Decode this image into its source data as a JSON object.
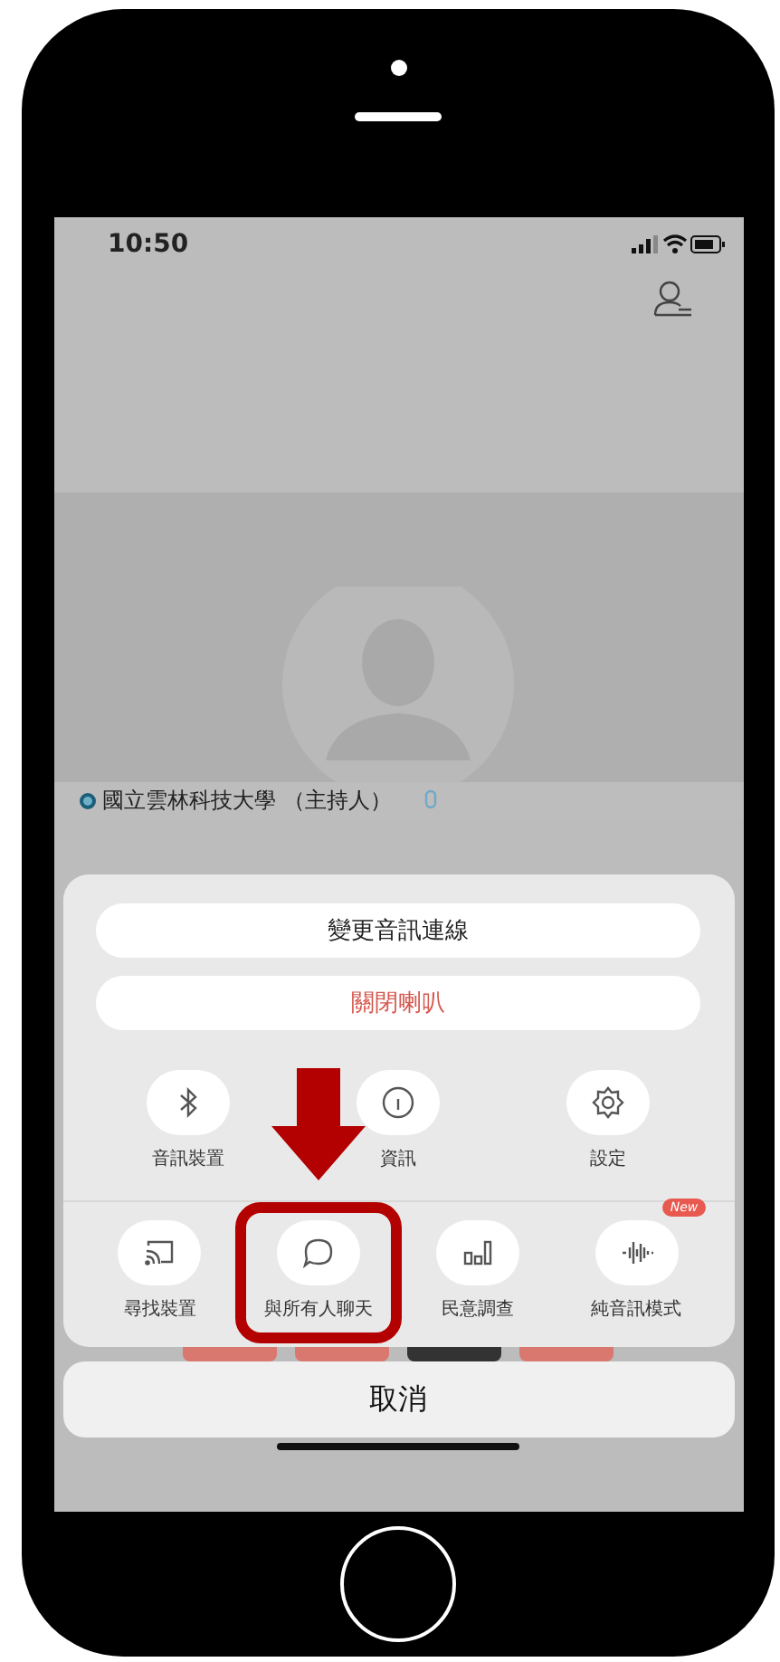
{
  "status_bar": {
    "time": "10:50"
  },
  "participant": {
    "name": "國立雲林科技大學 （主持人）"
  },
  "sheet": {
    "buttons": [
      {
        "label": "變更音訊連線",
        "kind": "normal"
      },
      {
        "label": "關閉喇叭",
        "kind": "danger"
      }
    ],
    "rows": [
      {
        "items": [
          {
            "label": "音訊裝置",
            "highlighted": false
          },
          {
            "label": "資訊",
            "highlighted": false
          },
          {
            "label": "設定",
            "highlighted": false
          }
        ]
      },
      {
        "items": [
          {
            "label": "尋找裝置",
            "highlighted": false
          },
          {
            "label": "與所有人聊天",
            "highlighted": true
          },
          {
            "label": "民意調查",
            "highlighted": false
          },
          {
            "label": "純音訊模式",
            "highlighted": false,
            "badge": "New"
          }
        ]
      }
    ]
  },
  "cancel": {
    "label": "取消"
  }
}
